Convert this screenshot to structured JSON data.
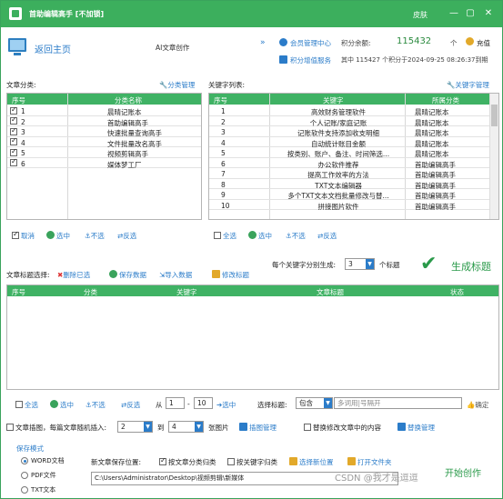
{
  "window": {
    "title": "首助编辑高手 [不加锁]",
    "skin_label": "皮肤",
    "controls": [
      "—",
      "▢",
      "✕"
    ]
  },
  "header": {
    "home_label": "返回主页",
    "ai_label": "AI文章创作",
    "member_center": "会员管理中心",
    "points_balance_label": "积分余额:",
    "points_value": "115432",
    "points_unit": "个",
    "recharge": "充值",
    "points_service": "积分增值服务",
    "points_detail": "其中 115427 个积分于2024-09-25 08:26:37到期"
  },
  "left": {
    "label": "文章分类:",
    "manage": "分类管理",
    "columns": [
      "序号",
      "分类名称"
    ],
    "rows": [
      {
        "no": "1",
        "name": "晨晴记账本",
        "checked": true
      },
      {
        "no": "2",
        "name": "首助编辑高手",
        "checked": true
      },
      {
        "no": "3",
        "name": "快速批量查询高手",
        "checked": true
      },
      {
        "no": "4",
        "name": "文件批量改名高手",
        "checked": true
      },
      {
        "no": "5",
        "name": "视频剪辑高手",
        "checked": true
      },
      {
        "no": "6",
        "name": "媒体梦工厂",
        "checked": true
      }
    ],
    "actions": [
      "取消",
      "选中",
      "不选",
      "反选"
    ]
  },
  "right": {
    "label": "关键字列表:",
    "manage": "关键字管理",
    "columns": [
      "序号",
      "关键字",
      "所属分类"
    ],
    "rows": [
      {
        "no": "1",
        "kw": "高效财务管理软件",
        "cat": "晨晴记账本"
      },
      {
        "no": "2",
        "kw": "个人记账/家庭记账",
        "cat": "晨晴记账本"
      },
      {
        "no": "3",
        "kw": "记账软件支持添加收支明细",
        "cat": "晨晴记账本"
      },
      {
        "no": "4",
        "kw": "自动统计账目金额",
        "cat": "晨晴记账本"
      },
      {
        "no": "5",
        "kw": "按类别、账户、备注、时间筛选...",
        "cat": "晨晴记账本"
      },
      {
        "no": "6",
        "kw": "办公软件推荐",
        "cat": "首助编辑高手"
      },
      {
        "no": "7",
        "kw": "提高工作效率的方法",
        "cat": "首助编辑高手"
      },
      {
        "no": "8",
        "kw": "TXT文本编辑器",
        "cat": "首助编辑高手"
      },
      {
        "no": "9",
        "kw": "多个TXT文本文档批量修改与替...",
        "cat": "首助编辑高手"
      },
      {
        "no": "10",
        "kw": "拼接图片软件",
        "cat": "首助编辑高手"
      }
    ],
    "actions": [
      "全选",
      "选中",
      "不选",
      "反选"
    ]
  },
  "gen": {
    "per_kw_label": "每个关键字分别生成:",
    "per_kw_value": "3",
    "per_kw_unit": "个标题",
    "generate": "生成标题"
  },
  "titles": {
    "label": "文章标题选择:",
    "toolbar": [
      "删除已选",
      "保存数据",
      "导入数据",
      "修改标题"
    ],
    "columns": [
      "序号",
      "分类",
      "关键字",
      "文章标题",
      "状态"
    ]
  },
  "bottom": {
    "actions": [
      "全选",
      "选中",
      "不选",
      "反选"
    ],
    "from_label": "从",
    "from_value": "1",
    "dash": "-",
    "to_value": "10",
    "select_label": "选中",
    "choose_title": "选择标题:",
    "contains": "包含",
    "filter_placeholder": "多词用|号隔开",
    "confirm": "确定",
    "insert_img_label": "文章插图，每篇文章随机插入:",
    "img_min": "2",
    "img_to": "到",
    "img_max": "4",
    "img_unit": "张图片",
    "img_manage": "插图管理",
    "replace_label": "替换修改文章中的内容",
    "replace_manage": "替换管理",
    "save_mode_label": "保存模式",
    "save_modes": [
      "WORD文档",
      "PDF文件",
      "TXT文本"
    ],
    "save_path_label": "新文章保存位置:",
    "by_category": "按文章分类归类",
    "by_keyword": "按关键字归类",
    "choose_location": "选择新位置",
    "open_folder": "打开文件夹",
    "save_path": "C:\\Users\\Administrator\\Desktop\\视频剪辑\\新媒体",
    "start": "开始创作",
    "watermark": "CSDN @我才是逗逗"
  }
}
